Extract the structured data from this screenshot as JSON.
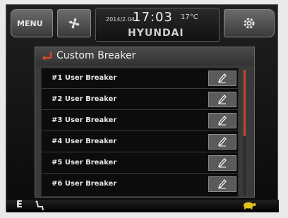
{
  "topbar": {
    "menu_label": "MENU",
    "date": "2014/2.04",
    "time": "17:03",
    "temperature": "17°C",
    "brand": "HYUNDAI",
    "icons": {
      "fan": "fan-icon",
      "settings": "gear-icon"
    }
  },
  "dialog": {
    "title": "Custom Breaker",
    "edit_icon": "pencil-icon",
    "items": [
      {
        "label": "#1 User Breaker"
      },
      {
        "label": "#2 User Breaker"
      },
      {
        "label": "#3 User Breaker"
      },
      {
        "label": "#4 User Breaker"
      },
      {
        "label": "#5 User Breaker"
      },
      {
        "label": "#6 User Breaker"
      }
    ],
    "scrollbar": {
      "thumb_color": "#c04a2a",
      "visible_fraction": 0.53
    }
  },
  "bottombar": {
    "compass": "E",
    "icons": {
      "seat": "seat-icon",
      "status": "turtle-icon"
    }
  },
  "colors": {
    "accent": "#c04a2a",
    "background": "#0c0c0c",
    "turtle": "#e0c21c"
  }
}
